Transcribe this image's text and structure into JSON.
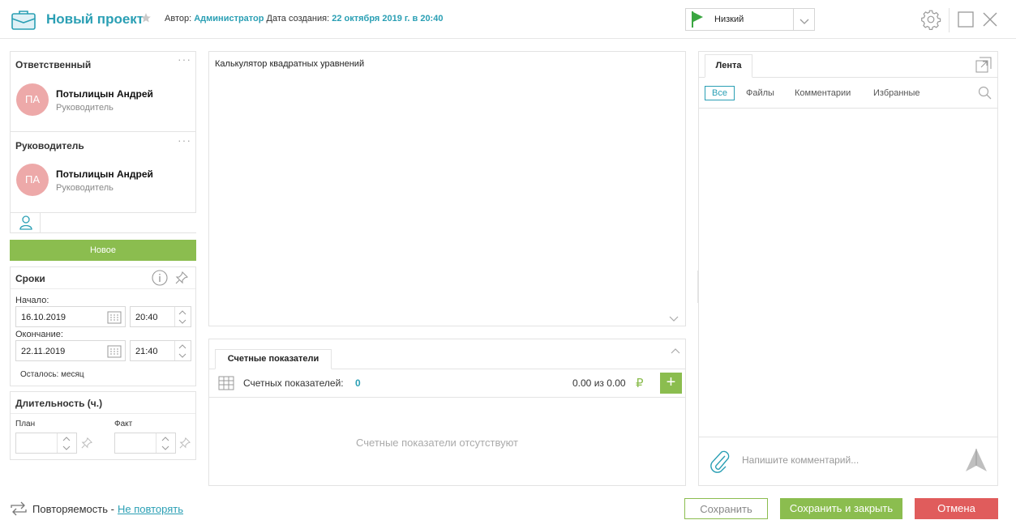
{
  "header": {
    "title": "Новый проект",
    "author_label": "Автор:",
    "author": "Администратор",
    "created_label": "Дата создания:",
    "created": "22 октября 2019 г. в 20:40",
    "priority": "Низкий",
    "priority_color": "#3aa641"
  },
  "responsible": {
    "title": "Ответственный",
    "initials": "ПА",
    "name": "Потылицын Андрей",
    "role": "Руководитель"
  },
  "manager": {
    "title": "Руководитель",
    "initials": "ПА",
    "name": "Потылицын Андрей",
    "role": "Руководитель"
  },
  "status": "Новое",
  "deadlines": {
    "title": "Сроки",
    "start_label": "Начало:",
    "start_date": "16.10.2019",
    "start_time": "20:40",
    "end_label": "Окончание:",
    "end_date": "22.11.2019",
    "end_time": "21:40",
    "remaining": "Осталось: месяц"
  },
  "duration": {
    "title": "Длительность (ч.)",
    "plan_label": "План",
    "fact_label": "Факт"
  },
  "description": {
    "text": "Калькулятор квадратных уравнений"
  },
  "metrics": {
    "tab": "Счетные показатели",
    "count_label": "Счетных показателей:",
    "count": "0",
    "sum": "0.00 из 0.00",
    "currency": "₽",
    "add": "+",
    "empty": "Счетные показатели отсутствуют"
  },
  "feed": {
    "tab": "Лента",
    "filters": [
      "Все",
      "Файлы",
      "Комментарии",
      "Избранные"
    ],
    "comment_placeholder": "Напишите комментарий..."
  },
  "footer": {
    "repeat_label": "Повторяемость -",
    "repeat_value": "Не повторять",
    "save": "Сохранить",
    "save_close": "Сохранить и закрыть",
    "cancel": "Отмена"
  },
  "colors": {
    "accent": "#2a9fb4",
    "green": "#8bbd4f",
    "red": "#e05c5c",
    "avatar": "#eda9a9"
  }
}
